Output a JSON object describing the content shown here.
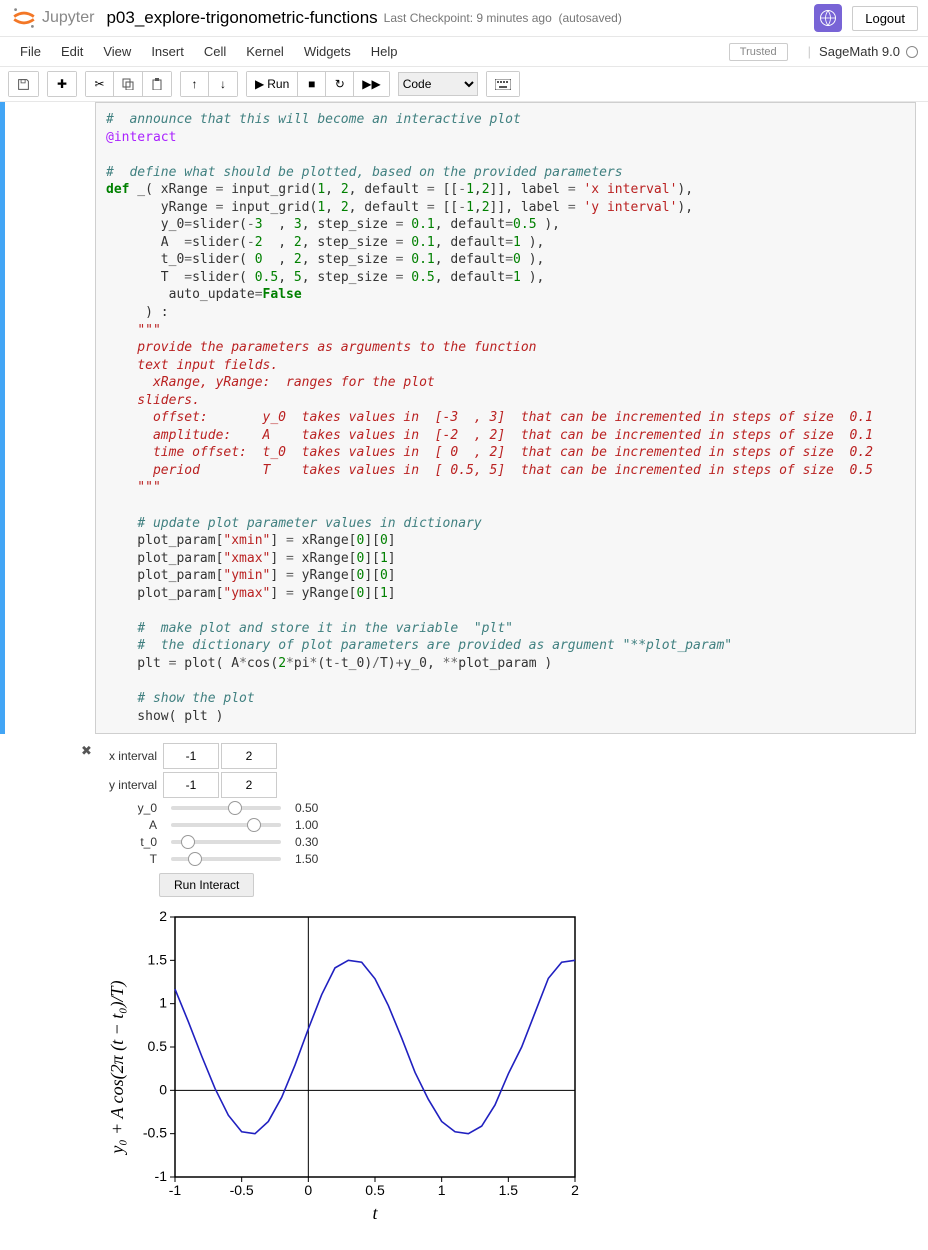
{
  "header": {
    "jupyter": "Jupyter",
    "notebook_name": "p03_explore-trigonometric-functions",
    "checkpoint": "Last Checkpoint: 9 minutes ago",
    "autosave": "(autosaved)",
    "logout": "Logout"
  },
  "menu": {
    "file": "File",
    "edit": "Edit",
    "view": "View",
    "insert": "Insert",
    "cell": "Cell",
    "kernel": "Kernel",
    "widgets": "Widgets",
    "help": "Help",
    "trusted": "Trusted",
    "kernel_name": "SageMath 9.0"
  },
  "toolbar": {
    "run_label": "Run",
    "cell_type": "Code"
  },
  "interact": {
    "x_label": "x interval",
    "y_label": "y interval",
    "x_min": "-1",
    "x_max": "2",
    "y_min": "-1",
    "y_max": "2",
    "y0_label": "y_0",
    "y0_value": "0.50",
    "A_label": "A",
    "A_value": "1.00",
    "t0_label": "t_0",
    "t0_value": "0.30",
    "T_label": "T",
    "T_value": "1.50",
    "run_interact": "Run Interact"
  },
  "slider_positions": {
    "y0_pct": 58,
    "A_pct": 75,
    "t0_pct": 15,
    "T_pct": 22
  },
  "chart_data": {
    "type": "line",
    "title": "",
    "xlabel": "t",
    "ylabel": "y₀ + A cos(2π (t − t₀)/T)",
    "xlim": [
      -1,
      2
    ],
    "ylim": [
      -1,
      2
    ],
    "xticks": [
      -1,
      -0.5,
      0,
      0.5,
      1,
      1.5,
      2
    ],
    "yticks": [
      -1,
      -0.5,
      0,
      0.5,
      1,
      1.5,
      2
    ],
    "params": {
      "y0": 0.5,
      "A": 1.0,
      "t0": 0.3,
      "T": 1.5
    },
    "series": [
      {
        "name": "curve",
        "x": [
          -1.0,
          -0.9,
          -0.8,
          -0.7,
          -0.6,
          -0.5,
          -0.4,
          -0.3,
          -0.2,
          -0.1,
          0.0,
          0.1,
          0.2,
          0.3,
          0.4,
          0.5,
          0.6,
          0.7,
          0.8,
          0.9,
          1.0,
          1.1,
          1.2,
          1.3,
          1.4,
          1.5,
          1.6,
          1.7,
          1.8,
          1.9,
          2.0
        ],
        "y": [
          1.169,
          0.792,
          0.396,
          0.022,
          -0.287,
          -0.478,
          -0.5,
          -0.359,
          -0.082,
          0.292,
          0.709,
          1.104,
          1.413,
          1.5,
          1.478,
          1.287,
          0.978,
          0.604,
          0.208,
          -0.104,
          -0.359,
          -0.478,
          -0.5,
          -0.413,
          -0.169,
          0.191,
          0.5,
          0.896,
          1.292,
          1.478,
          1.5
        ]
      }
    ]
  }
}
